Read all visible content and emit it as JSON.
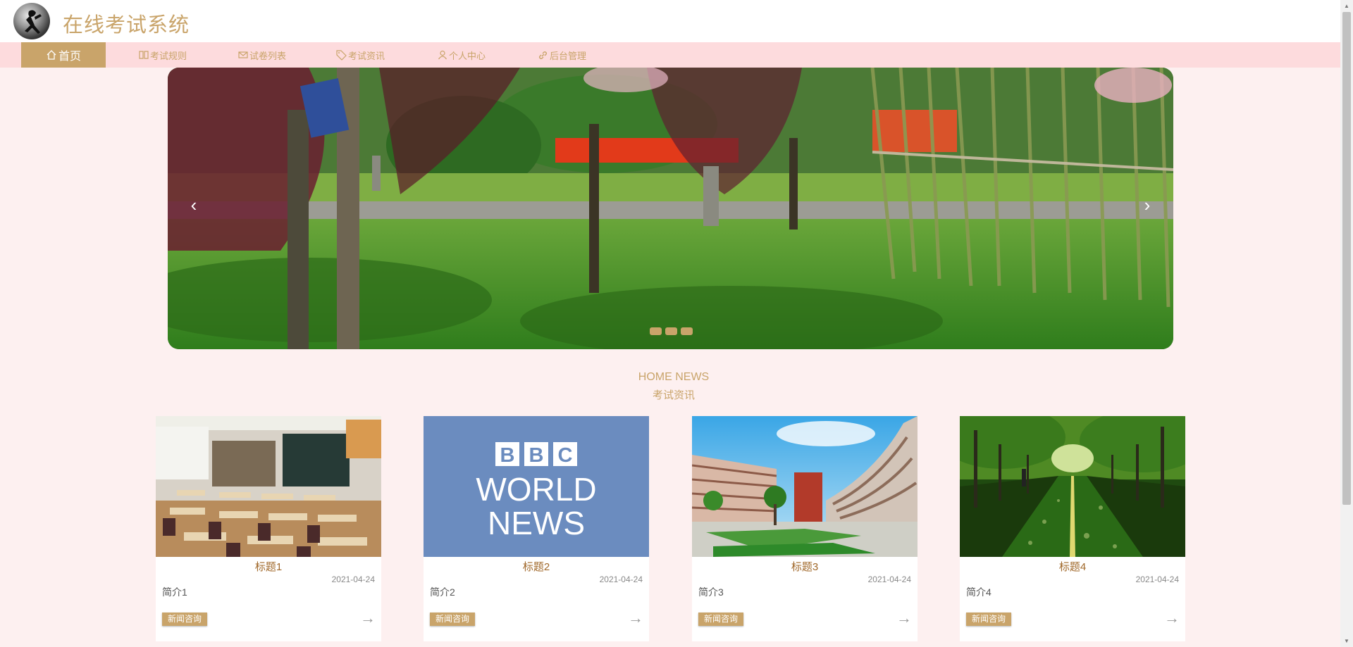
{
  "header": {
    "title": "在线考试系统",
    "logo_icon": "runner-logo-icon"
  },
  "nav": {
    "items": [
      {
        "label": "首页",
        "icon": "home-icon",
        "active": true
      },
      {
        "label": "考试规则",
        "icon": "book-icon",
        "active": false
      },
      {
        "label": "试卷列表",
        "icon": "mail-icon",
        "active": false
      },
      {
        "label": "考试资讯",
        "icon": "tag-icon",
        "active": false
      },
      {
        "label": "个人中心",
        "icon": "user-icon",
        "active": false
      },
      {
        "label": "后台管理",
        "icon": "link-icon",
        "active": false
      }
    ]
  },
  "carousel": {
    "prev_label": "‹",
    "next_label": "›",
    "slide_count": 3
  },
  "news_section": {
    "title_en": "HOME NEWS",
    "title_zh": "考试资讯"
  },
  "news": [
    {
      "title": "标题1",
      "date": "2021-04-24",
      "intro": "简介1",
      "tag": "新闻咨询",
      "arrow": "→",
      "image": "classroom"
    },
    {
      "title": "标题2",
      "date": "2021-04-24",
      "intro": "简介2",
      "tag": "新闻咨询",
      "arrow": "→",
      "image": "bbc-world-news"
    },
    {
      "title": "标题3",
      "date": "2021-04-24",
      "intro": "简介3",
      "tag": "新闻咨询",
      "arrow": "→",
      "image": "campus-building"
    },
    {
      "title": "标题4",
      "date": "2021-04-24",
      "intro": "简介4",
      "tag": "新闻咨询",
      "arrow": "→",
      "image": "tree-lined-road"
    }
  ],
  "bbc_logo": {
    "letters": [
      "B",
      "B",
      "C"
    ],
    "line1": "WORLD",
    "line2": "NEWS"
  },
  "colors": {
    "accent": "#c9a46a",
    "nav_bg": "#fddbdd",
    "page_bg": "#fdf0f0"
  }
}
